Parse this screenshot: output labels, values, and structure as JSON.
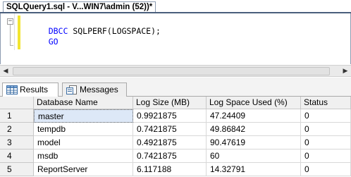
{
  "document_tab": {
    "title": "SQLQuery1.sql - V...WIN7\\admin (52))*"
  },
  "editor": {
    "lines": [
      {
        "keyword": "DBCC",
        "rest": " SQLPERF(LOGSPACE);"
      },
      {
        "keyword": "GO",
        "rest": ""
      }
    ],
    "collapse_glyph": "−",
    "colors": {
      "keyword": "#0000ff",
      "change_bar": "#f2e431"
    }
  },
  "scrollbar": {
    "left_arrow": "◀",
    "right_arrow": "▶"
  },
  "results_tabs": [
    {
      "label": "Results",
      "icon": "grid-icon",
      "active": true
    },
    {
      "label": "Messages",
      "icon": "messages-icon",
      "active": false
    }
  ],
  "grid": {
    "columns": [
      "Database Name",
      "Log Size (MB)",
      "Log Space Used (%)",
      "Status"
    ],
    "rows": [
      {
        "num": "1",
        "cells": [
          "master",
          "0.9921875",
          "47.24409",
          "0"
        ]
      },
      {
        "num": "2",
        "cells": [
          "tempdb",
          "0.7421875",
          "49.86842",
          "0"
        ]
      },
      {
        "num": "3",
        "cells": [
          "model",
          "0.4921875",
          "90.47619",
          "0"
        ]
      },
      {
        "num": "4",
        "cells": [
          "msdb",
          "0.7421875",
          "60",
          "0"
        ]
      },
      {
        "num": "5",
        "cells": [
          "ReportServer",
          "6.117188",
          "14.32791",
          "0"
        ]
      }
    ]
  }
}
